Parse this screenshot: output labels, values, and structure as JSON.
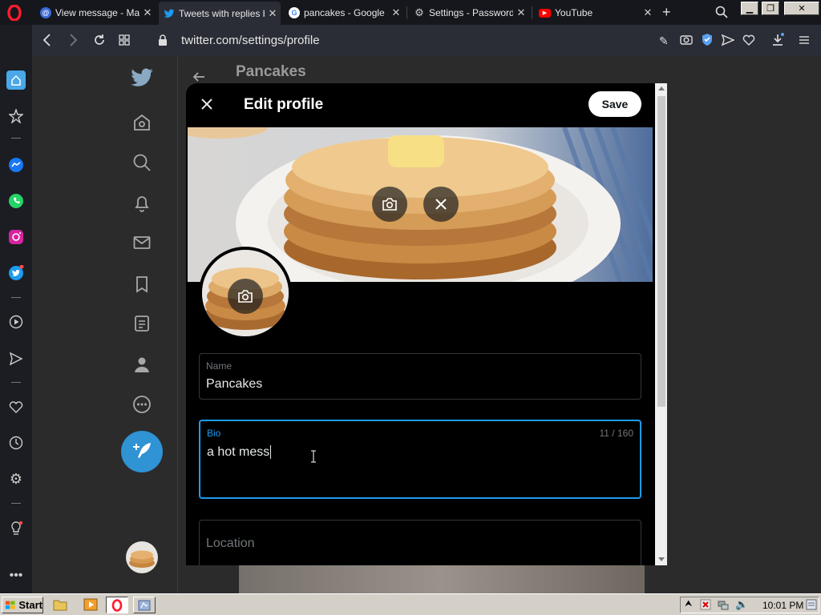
{
  "browser": {
    "tabs": [
      {
        "title": "View message - Mail",
        "icon": "mail-at-icon",
        "color": "#3b6ad8"
      },
      {
        "title": "Tweets with replies b",
        "icon": "twitter-icon",
        "color": "#1d9bf0"
      },
      {
        "title": "pancakes - Google Se",
        "icon": "google-icon",
        "color": "#ffffff"
      },
      {
        "title": "Settings - Passwords",
        "icon": "gear-icon",
        "color": "#cccccc"
      },
      {
        "title": "YouTube",
        "icon": "youtube-icon",
        "color": "#ff0000"
      }
    ],
    "address": "twitter.com/settings/profile"
  },
  "twitter": {
    "page_title": "Pancakes"
  },
  "modal": {
    "title": "Edit profile",
    "save_label": "Save",
    "fields": {
      "name": {
        "label": "Name",
        "value": "Pancakes"
      },
      "bio": {
        "label": "Bio",
        "value": "a hot mess",
        "count": "11 / 160"
      },
      "location": {
        "placeholder": "Location"
      }
    }
  },
  "taskbar": {
    "start_label": "Start",
    "clock": "10:01 PM"
  },
  "colors": {
    "accent": "#1d9bf0",
    "tweet_button": "#2f93d4"
  }
}
